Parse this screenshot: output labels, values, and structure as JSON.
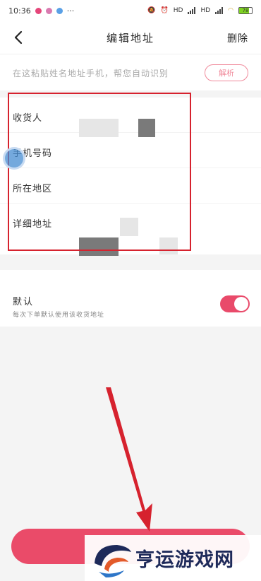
{
  "status_bar": {
    "time": "10:36",
    "dots": "···",
    "hd1": "HD",
    "hd2": "HD",
    "battery": "78"
  },
  "nav": {
    "title": "编辑地址",
    "delete_label": "删除"
  },
  "paste": {
    "placeholder": "在这粘贴姓名地址手机，帮您自动识别",
    "parse_label": "解析"
  },
  "form": {
    "fields": [
      {
        "label": "收货人"
      },
      {
        "label": "手机号码"
      },
      {
        "label": "所在地区"
      },
      {
        "label": "详细地址"
      }
    ]
  },
  "default_setting": {
    "label": "默认",
    "description": "每次下单默认使用该收货地址",
    "enabled": true
  },
  "watermark": {
    "text": "亨运游戏网"
  },
  "colors": {
    "accent": "#ea4b69",
    "annotation_red": "#d6222e"
  }
}
